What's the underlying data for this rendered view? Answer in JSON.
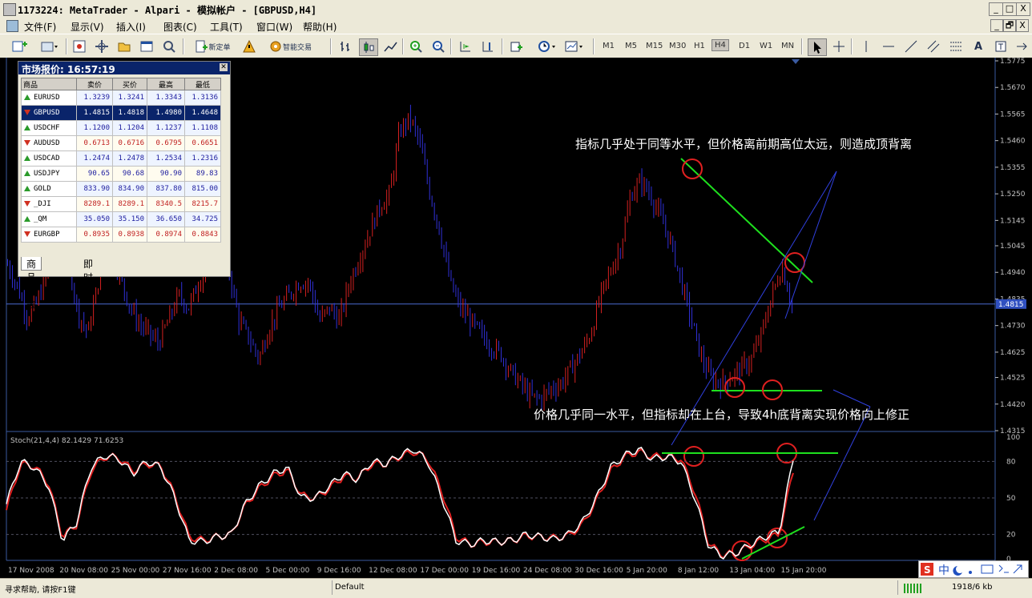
{
  "window": {
    "title": "1173224: MetaTrader - Alpari - 模拟帐户 - [GBPUSD,H4]",
    "controls": [
      "_",
      "□",
      "X"
    ],
    "inner_controls": [
      "_",
      "🗗",
      "X"
    ]
  },
  "menu": {
    "items": [
      "文件(F)",
      "显示(V)",
      "插入(I)",
      "图表(C)",
      "工具(T)",
      "窗口(W)",
      "帮助(H)"
    ]
  },
  "toolbar": {
    "new_order_label": "新定单",
    "expert_label": "智能交易",
    "timeframes": [
      "M1",
      "M5",
      "M15",
      "M30",
      "H1",
      "H4",
      "D1",
      "W1",
      "MN"
    ],
    "active_timeframe": "H4"
  },
  "market_watch": {
    "title": "市场报价: 16:57:19",
    "columns": [
      "商品",
      "卖价",
      "买价",
      "最高",
      "最低"
    ],
    "rows": [
      {
        "symbol": "EURUSD",
        "dir": "up",
        "bid": "1.3239",
        "ask": "1.3241",
        "high": "1.3343",
        "low": "1.3136"
      },
      {
        "symbol": "GBPUSD",
        "dir": "down",
        "bid": "1.4815",
        "ask": "1.4818",
        "high": "1.4980",
        "low": "1.4648"
      },
      {
        "symbol": "USDCHF",
        "dir": "up",
        "bid": "1.1200",
        "ask": "1.1204",
        "high": "1.1237",
        "low": "1.1108"
      },
      {
        "symbol": "AUDUSD",
        "dir": "down",
        "bid": "0.6713",
        "ask": "0.6716",
        "high": "0.6795",
        "low": "0.6651"
      },
      {
        "symbol": "USDCAD",
        "dir": "up",
        "bid": "1.2474",
        "ask": "1.2478",
        "high": "1.2534",
        "low": "1.2316"
      },
      {
        "symbol": "USDJPY",
        "dir": "up",
        "bid": "90.65",
        "ask": "90.68",
        "high": "90.90",
        "low": "89.83"
      },
      {
        "symbol": "GOLD",
        "dir": "up",
        "bid": "833.90",
        "ask": "834.90",
        "high": "837.80",
        "low": "815.00"
      },
      {
        "symbol": "_DJI",
        "dir": "down",
        "bid": "8289.1",
        "ask": "8289.1",
        "high": "8340.5",
        "low": "8215.7"
      },
      {
        "symbol": "_QM",
        "dir": "up",
        "bid": "35.050",
        "ask": "35.150",
        "high": "36.650",
        "low": "34.725"
      },
      {
        "symbol": "EURGBP",
        "dir": "down",
        "bid": "0.8935",
        "ask": "0.8938",
        "high": "0.8974",
        "low": "0.8843"
      }
    ],
    "selected_index": 1,
    "tabs": [
      "商品列表",
      "即时图"
    ]
  },
  "chart": {
    "symbol": "GBPUSD",
    "timeframe": "H4",
    "price_ticks": [
      "1.5775",
      "1.5670",
      "1.5565",
      "1.5460",
      "1.5355",
      "1.5250",
      "1.5145",
      "1.5045",
      "1.4940",
      "1.4835",
      "1.4730",
      "1.4625",
      "1.4525",
      "1.4420",
      "1.4315"
    ],
    "current_price": "1.4815",
    "time_labels": [
      "17 Nov 2008",
      "20 Nov 08:00",
      "25 Nov 00:00",
      "27 Nov 16:00",
      "2 Dec 08:00",
      "5 Dec 00:00",
      "9 Dec 16:00",
      "12 Dec 08:00",
      "17 Dec 00:00",
      "19 Dec 16:00",
      "24 Dec 08:00",
      "30 Dec 16:00",
      "5 Jan 20:00",
      "8 Jan 12:00",
      "13 Jan 04:00",
      "15 Jan 20:00"
    ],
    "annotation_top": "指标几乎处于同等水平，但价格离前期高位太远，则造成顶背离",
    "annotation_bottom": "价格几乎同一水平，但指标却在上台，导致4h底背离实现价格向上修正",
    "colors": {
      "bull": "#d42020",
      "bear": "#3030d8",
      "grid": "#404040",
      "annotation": "#1ee01e",
      "circle": "#e02020",
      "trend": "#3040e0"
    }
  },
  "indicator": {
    "label": "Stoch(21,4,4) 82.1429 71.6253",
    "levels": [
      "100",
      "80",
      "50",
      "20",
      "0"
    ]
  },
  "chart_data": {
    "type": "line",
    "series": [
      {
        "name": "GBPUSD",
        "values": [
          1.497,
          1.488,
          1.476,
          1.483,
          1.494,
          1.505,
          1.5,
          1.478,
          1.47,
          1.49,
          1.503,
          1.495,
          1.482,
          1.474,
          1.47,
          1.466,
          1.475,
          1.485,
          1.48,
          1.49,
          1.498,
          1.503,
          1.495,
          1.475,
          1.468,
          1.46,
          1.472,
          1.48,
          1.485,
          1.49,
          1.49,
          1.475,
          1.48,
          1.475,
          1.49,
          1.5,
          1.51,
          1.52,
          1.525,
          1.55,
          1.555,
          1.545,
          1.525,
          1.51,
          1.49,
          1.48,
          1.475,
          1.47,
          1.465,
          1.462,
          1.455,
          1.45,
          1.445,
          1.444,
          1.448,
          1.45,
          1.456,
          1.462,
          1.47,
          1.485,
          1.495,
          1.505,
          1.525,
          1.53,
          1.524,
          1.515,
          1.505,
          1.49,
          1.475,
          1.46,
          1.452,
          1.45,
          1.453,
          1.456,
          1.46,
          1.47,
          1.485,
          1.496,
          1.4815
        ]
      },
      {
        "name": "Stoch main",
        "values": [
          45,
          80,
          75,
          60,
          15,
          30,
          75,
          85,
          82,
          70,
          80,
          75,
          50,
          15,
          14,
          18,
          20,
          45,
          60,
          70,
          75,
          50,
          50,
          60,
          70,
          65,
          80,
          78,
          85,
          90,
          80,
          50,
          15,
          12,
          15,
          14,
          15,
          20,
          18,
          16,
          20,
          30,
          50,
          75,
          85,
          90,
          82,
          84,
          80,
          50,
          10,
          2,
          5,
          12,
          18,
          22,
          82
        ]
      },
      {
        "name": "Stoch signal",
        "values": [
          40,
          78,
          76,
          62,
          18,
          28,
          72,
          84,
          83,
          72,
          78,
          76,
          52,
          18,
          15,
          18,
          20,
          44,
          58,
          68,
          73,
          52,
          50,
          58,
          68,
          66,
          78,
          78,
          84,
          88,
          82,
          55,
          18,
          12,
          14,
          14,
          15,
          19,
          18,
          17,
          19,
          28,
          48,
          72,
          84,
          88,
          84,
          84,
          82,
          55,
          12,
          3,
          5,
          11,
          16,
          20,
          72
        ]
      }
    ],
    "y_range": [
      1.4315,
      1.5775
    ],
    "indicator_range": [
      0,
      100
    ]
  },
  "status": {
    "help": "寻求帮助, 请按F1键",
    "profile": "Default",
    "traffic": "1918/6 kb"
  },
  "ime": {
    "label": "中"
  }
}
